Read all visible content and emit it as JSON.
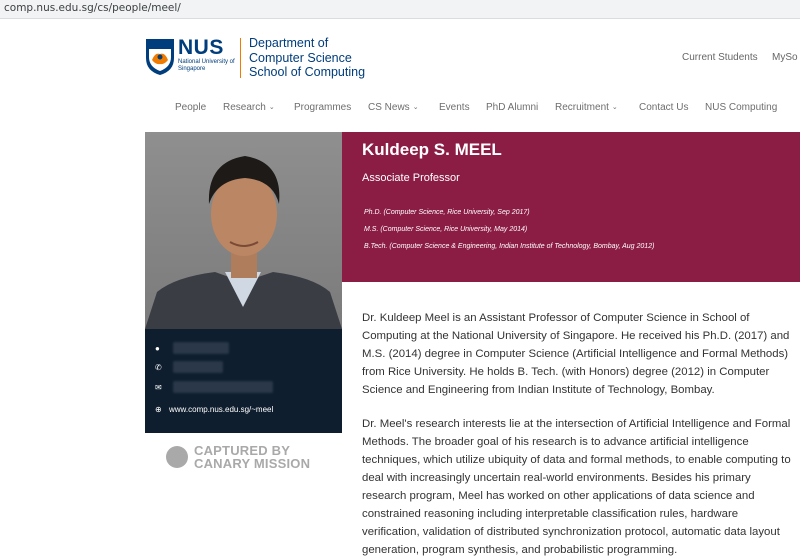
{
  "browser": {
    "url": "comp.nus.edu.sg/cs/people/meel/"
  },
  "header": {
    "logo_word": "NUS",
    "logo_sub": "National University of Singapore",
    "dept_lines": [
      "Department of",
      "Computer Science",
      "School of Computing"
    ],
    "top_links": [
      "Current Students",
      "MySo"
    ]
  },
  "nav": {
    "items": [
      {
        "label": "People"
      },
      {
        "label": "Research",
        "caret": "⌄"
      },
      {
        "label": "Programmes"
      },
      {
        "label": "CS News",
        "caret": "⌄"
      },
      {
        "label": "Events"
      },
      {
        "label": "PhD Alumni"
      },
      {
        "label": "Recruitment",
        "caret": "⌄"
      },
      {
        "label": "Contact Us"
      },
      {
        "label": "NUS Computing"
      }
    ]
  },
  "profile": {
    "name": "Kuldeep S. MEEL",
    "position": "Associate Professor",
    "degrees": [
      "Ph.D. (Computer Science, Rice University, Sep 2017)",
      "M.S. (Computer Science, Rice University, May 2014)",
      "B.Tech. (Computer Science & Engineering, Indian Institute of Technology, Bombay, Aug 2012)"
    ],
    "contact": {
      "website": "www.comp.nus.edu.sg/~meel"
    }
  },
  "stamp": {
    "line1": "CAPTURED BY",
    "line2": "CANARY MISSION"
  },
  "bio": {
    "p1": "Dr. Kuldeep Meel is an Assistant Professor of Computer Science in School of Computing at the National University of Singapore. He received his Ph.D. (2017) and M.S. (2014) degree in Computer Science (Artificial Intelligence and Formal Methods) from Rice University. He holds B. Tech. (with Honors) degree (2012) in Computer Science and Engineering from Indian Institute of Technology, Bombay.",
    "p2": "Dr. Meel's research interests lie at the intersection of Artificial Intelligence and Formal Methods. The broader goal of his research is to advance artificial intelligence techniques, which utilize ubiquity of data and formal methods, to enable computing to deal with increasingly uncertain real-world environments. Besides his primary research program, Meel has worked on other applications of data science and constrained reasoning including interpretable classification rules, hardware verification, validation of distributed synchronization protocol, automatic data layout generation, program synthesis, and probabilistic programming."
  },
  "colors": {
    "banner": "#8b1d44",
    "info_box": "#0f1e2e",
    "nus_blue": "#003d7c",
    "nus_orange": "#ef7c00"
  }
}
